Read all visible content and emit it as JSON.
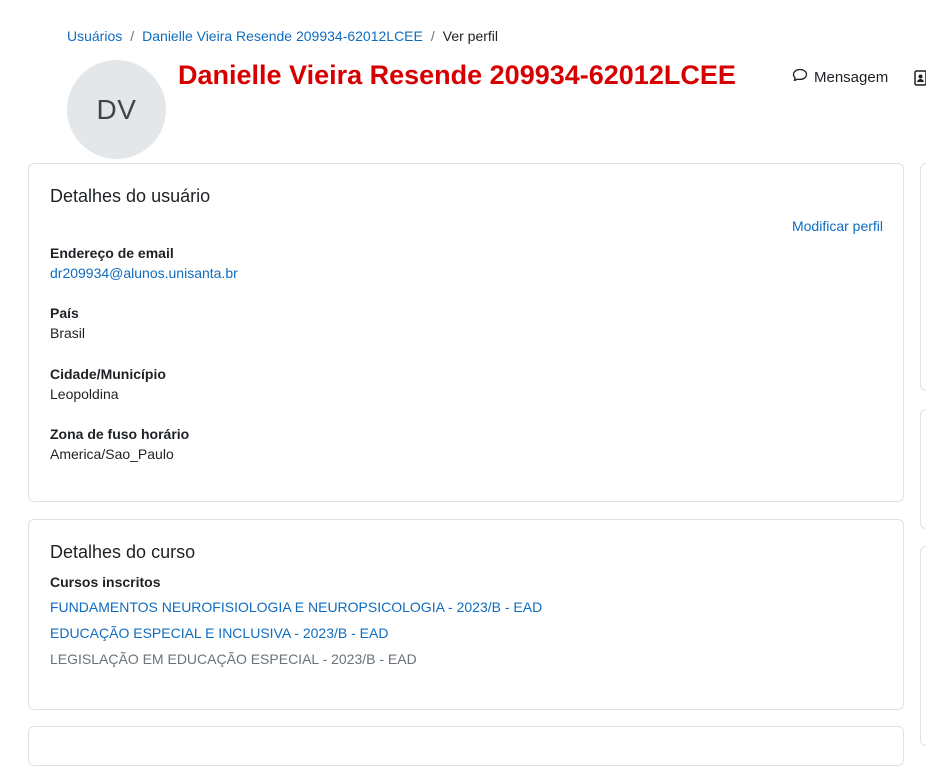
{
  "breadcrumb": {
    "items": [
      "Usuários",
      "Danielle Vieira Resende 209934-62012LCEE",
      "Ver perfil"
    ],
    "separator": "/"
  },
  "profile": {
    "initials": "DV",
    "name": "Danielle Vieira Resende 209934-62012LCEE",
    "title_color": "#d60000"
  },
  "header": {
    "message_label": "Mensagem",
    "message_icon": "speech-bubble-icon",
    "contact_icon": "add-contact-icon"
  },
  "user_details": {
    "title": "Detalhes do usuário",
    "edit_label": "Modificar perfil",
    "fields": [
      {
        "label": "Endereço de email",
        "value": "dr209934@alunos.unisanta.br"
      },
      {
        "label": "País",
        "value": "Brasil"
      },
      {
        "label": "Cidade/Município",
        "value": "Leopoldina"
      },
      {
        "label": "Zona de fuso horário",
        "value": "America/Sao_Paulo"
      }
    ]
  },
  "course_details": {
    "title": "Detalhes do curso",
    "enrolled_label": "Cursos inscritos",
    "courses": [
      "FUNDAMENTOS NEUROFISIOLOGIA E NEUROPSICOLOGIA - 2023/B - EAD",
      "EDUCAÇÃO ESPECIAL E INCLUSIVA - 2023/B - EAD",
      "LEGISLAÇÃO EM EDUCAÇÃO ESPECIAL - 2023/B - EAD"
    ]
  },
  "colors": {
    "link": "#0f6cbf",
    "muted": "#6a737b",
    "border": "#dee2e6"
  }
}
